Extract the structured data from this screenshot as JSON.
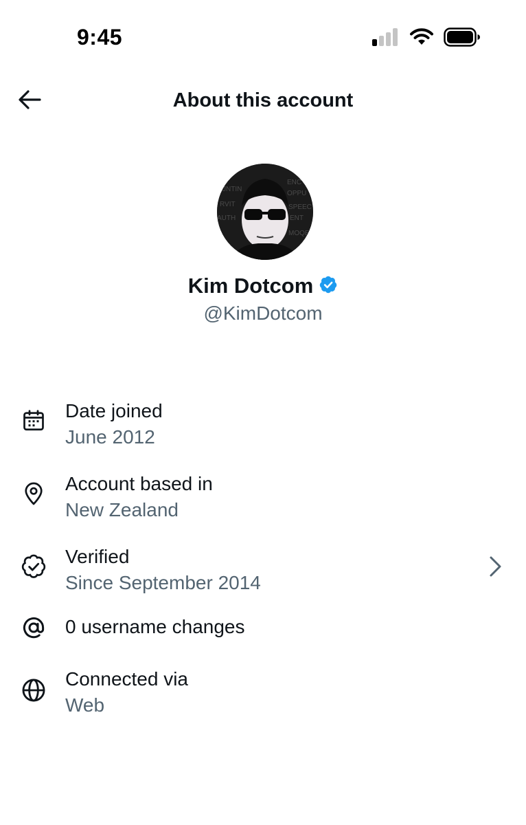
{
  "status_bar": {
    "time": "9:45",
    "icons": [
      "cellular-signal-icon",
      "wifi-icon",
      "battery-icon"
    ]
  },
  "header": {
    "back_icon": "arrow-left-icon",
    "title": "About this account"
  },
  "profile": {
    "name": "Kim Dotcom",
    "handle": "@KimDotcom",
    "verified_badge_icon": "verified-badge-icon",
    "verified_color": "#1d9bf0"
  },
  "info": [
    {
      "icon": "calendar-icon",
      "label": "Date joined",
      "value": "June 2012"
    },
    {
      "icon": "location-pin-icon",
      "label": "Account based in",
      "value": "New Zealand"
    },
    {
      "icon": "verified-outline-icon",
      "label": "Verified",
      "value": "Since September 2014",
      "has_chevron": true
    },
    {
      "icon": "at-sign-icon",
      "label": "0 username changes"
    },
    {
      "icon": "globe-icon",
      "label": "Connected via",
      "value": "Web"
    }
  ],
  "colors": {
    "primary_text": "#0f1419",
    "secondary_text": "#536471",
    "accent": "#1d9bf0"
  }
}
